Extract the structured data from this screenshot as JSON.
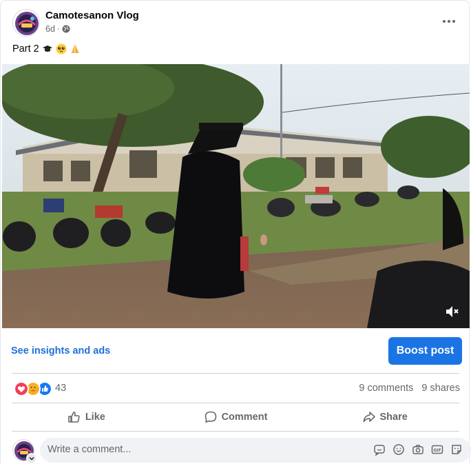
{
  "post": {
    "page_name": "Camotesanon Vlog",
    "time": "6d",
    "separator": "·",
    "audience_icon": "globe-icon",
    "caption_text": "Part 2",
    "caption_emojis": [
      "graduation-cap-emoji",
      "pleading-face-emoji",
      "folded-hands-emoji"
    ]
  },
  "video": {
    "mute_icon": "speaker-muted-icon"
  },
  "promo": {
    "insights_label": "See insights and ads",
    "boost_label": "Boost post",
    "boost_color": "#1b74e4",
    "link_color": "#216fdb"
  },
  "stats": {
    "reaction_icons": [
      "love-reaction",
      "care-reaction",
      "like-reaction"
    ],
    "reaction_count": "43",
    "comments": "9 comments",
    "shares": "9 shares"
  },
  "actions": {
    "like": "Like",
    "comment": "Comment",
    "share": "Share"
  },
  "composer": {
    "placeholder": "Write a comment...",
    "tools": [
      "sticker-icon",
      "emoji-icon",
      "camera-icon",
      "gif-icon",
      "avatar-sticker-icon"
    ]
  }
}
